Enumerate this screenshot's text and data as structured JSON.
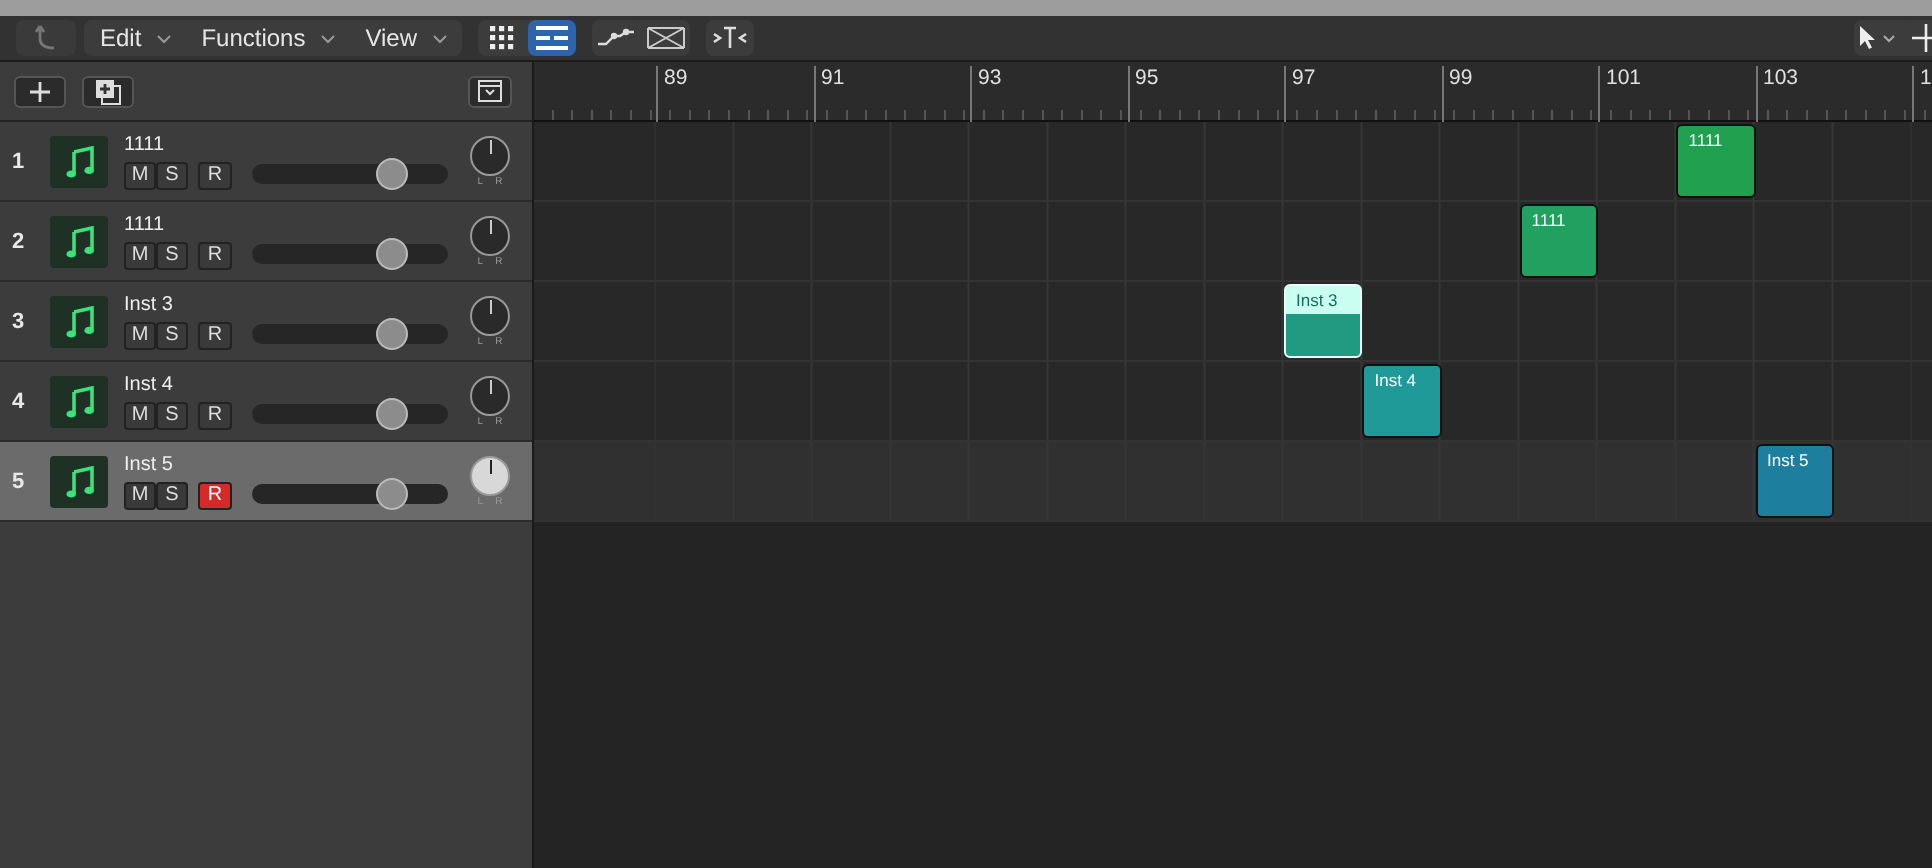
{
  "toolbar": {
    "menus": [
      {
        "label": "Edit"
      },
      {
        "label": "Functions"
      },
      {
        "label": "View"
      }
    ],
    "view_buttons": [
      {
        "kind": "grid",
        "selected": false
      },
      {
        "kind": "list",
        "selected": true
      }
    ]
  },
  "ruler": {
    "labels": [
      "89",
      "91",
      "93",
      "95",
      "97",
      "99",
      "101",
      "103",
      "1"
    ]
  },
  "tracks": [
    {
      "number": "1",
      "name": "1111",
      "mute": "M",
      "solo": "S",
      "record": "R",
      "record_armed": false,
      "selected": false,
      "level": 0.71,
      "pan_left": "L",
      "pan_right": "R"
    },
    {
      "number": "2",
      "name": "1111",
      "mute": "M",
      "solo": "S",
      "record": "R",
      "record_armed": false,
      "selected": false,
      "level": 0.71,
      "pan_left": "L",
      "pan_right": "R"
    },
    {
      "number": "3",
      "name": "Inst 3",
      "mute": "M",
      "solo": "S",
      "record": "R",
      "record_armed": false,
      "selected": false,
      "level": 0.71,
      "pan_left": "L",
      "pan_right": "R"
    },
    {
      "number": "4",
      "name": "Inst 4",
      "mute": "M",
      "solo": "S",
      "record": "R",
      "record_armed": false,
      "selected": false,
      "level": 0.71,
      "pan_left": "L",
      "pan_right": "R"
    },
    {
      "number": "5",
      "name": "Inst 5",
      "mute": "M",
      "solo": "S",
      "record": "R",
      "record_armed": true,
      "selected": true,
      "level": 0.71,
      "pan_left": "L",
      "pan_right": "R"
    }
  ],
  "regions": [
    {
      "label": "1111",
      "color": "#21a050",
      "selected": false
    },
    {
      "label": "1111",
      "color": "#21a060",
      "selected": false
    },
    {
      "label": "Inst 3",
      "color": "#209a80",
      "selected": true
    },
    {
      "label": "Inst 4",
      "color": "#1f9a98",
      "selected": false
    },
    {
      "label": "Inst 5",
      "color": "#1d7e9e",
      "selected": false
    }
  ]
}
